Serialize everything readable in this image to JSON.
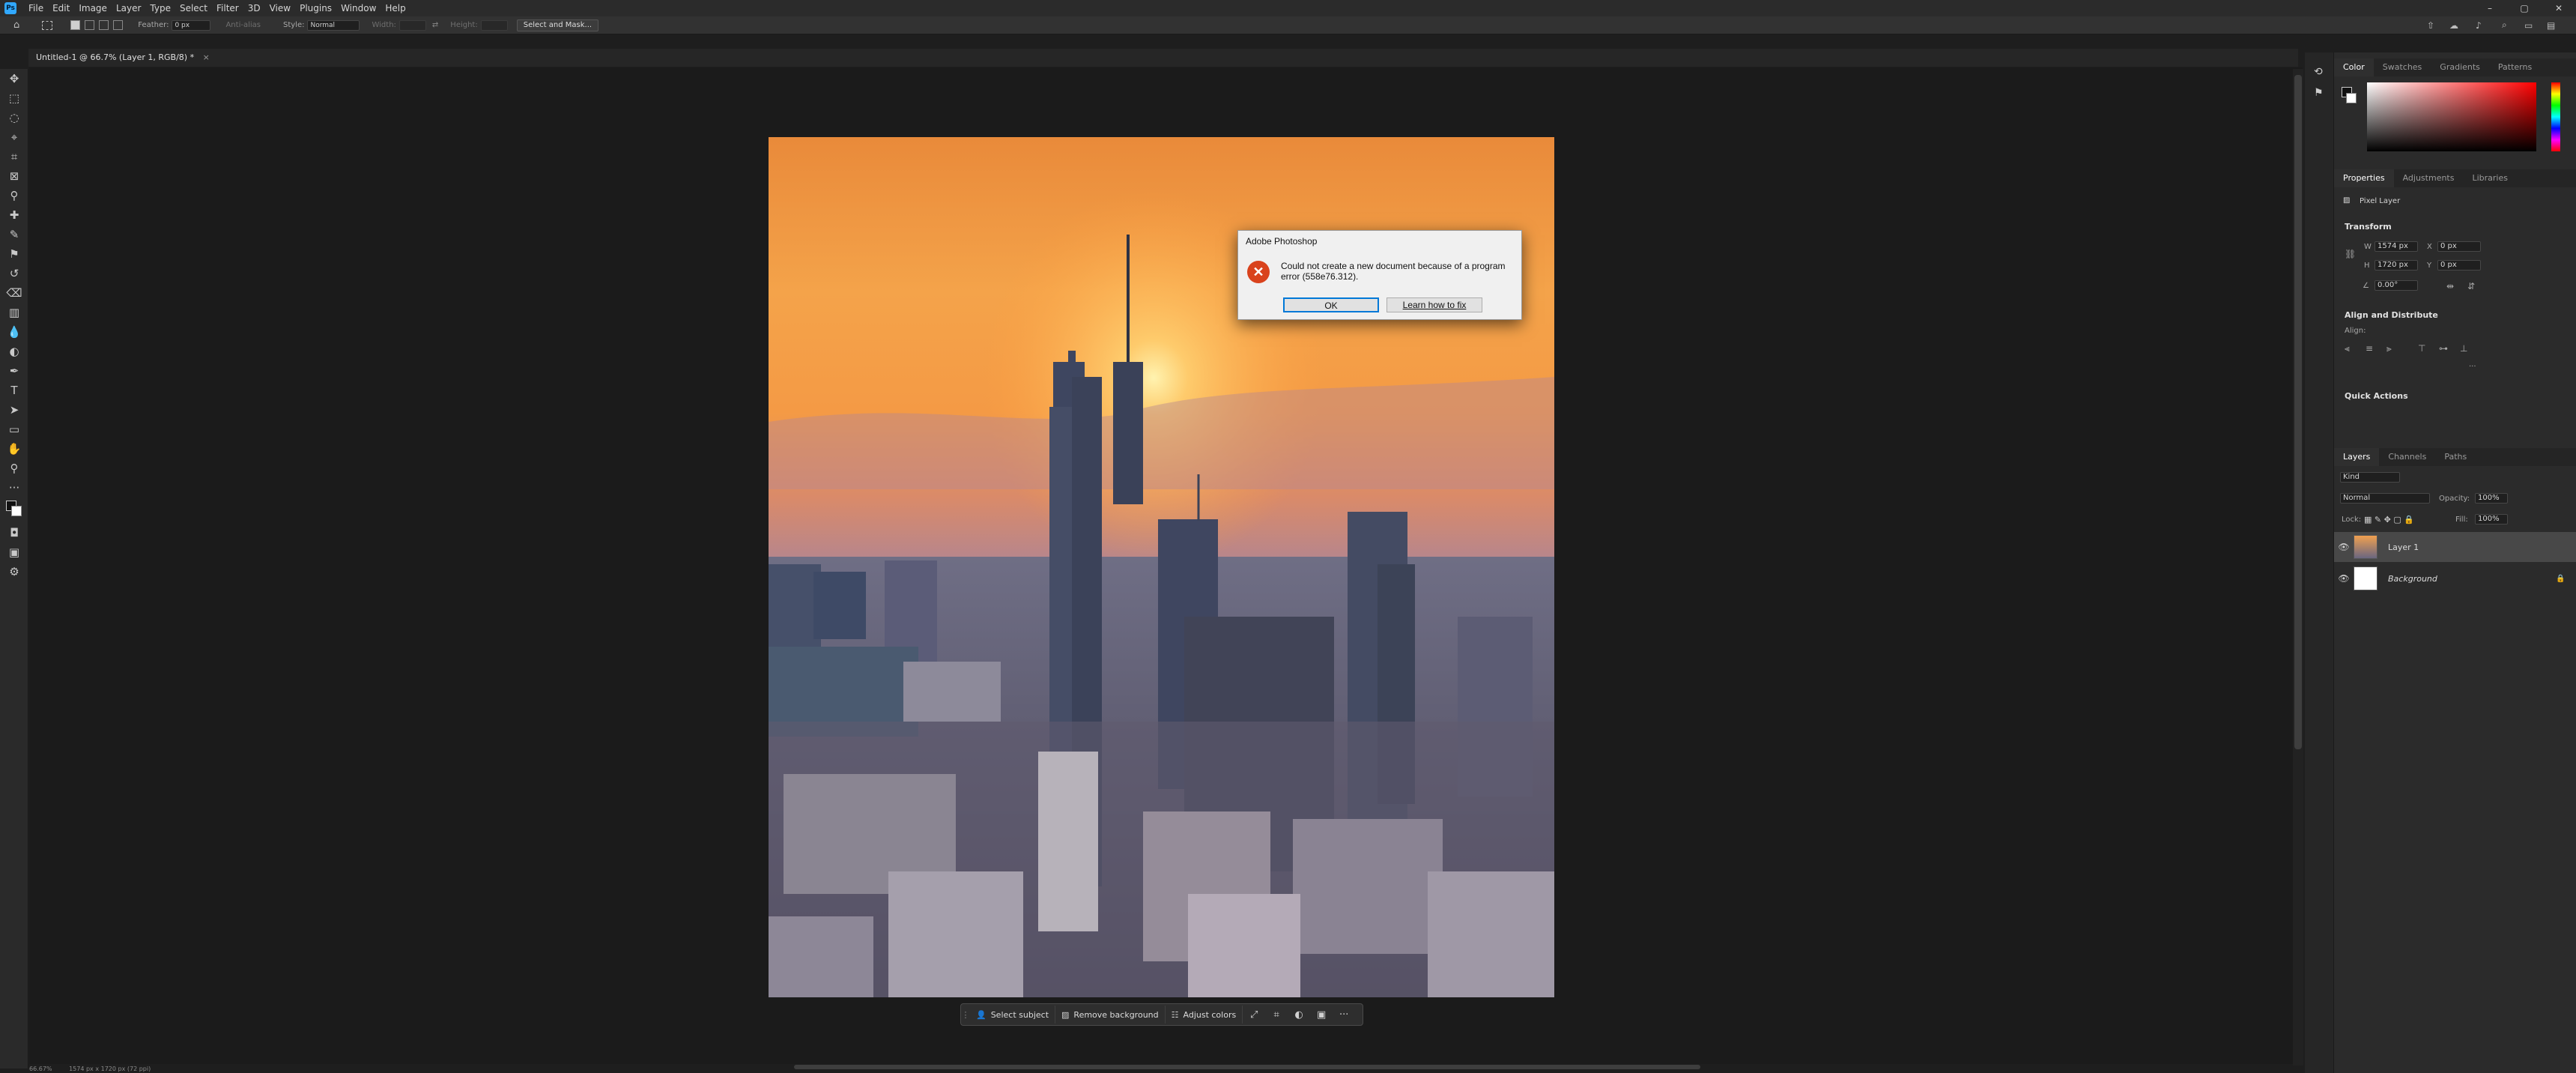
{
  "app": {
    "name": "Adobe Photoshop",
    "logo": "Ps"
  },
  "menu": [
    "File",
    "Edit",
    "Image",
    "Layer",
    "Type",
    "Select",
    "Filter",
    "3D",
    "View",
    "Plugins",
    "Window",
    "Help"
  ],
  "window_controls": {
    "minimize": "–",
    "maximize": "▢",
    "close": "✕"
  },
  "options_bar": {
    "feather_label": "Feather:",
    "feather_value": "0 px",
    "antialias_label": "Anti-alias",
    "style_label": "Style:",
    "style_value": "Normal",
    "width_label": "Width:",
    "height_label": "Height:",
    "select_mask_label": "Select and Mask..."
  },
  "document_tab": {
    "title": "Untitled-1 @ 66.7% (Layer 1, RGB/8) *",
    "close": "×"
  },
  "status": {
    "zoom": "66.67%",
    "info": "1574 px x 1720 px (72 ppi)"
  },
  "dialog": {
    "title": "Adobe Photoshop",
    "message": "Could not create a new document because of a program error (558e76.312).",
    "ok_label": "OK",
    "learn_label": "Learn how to fix"
  },
  "context_bar": {
    "select_subject": "Select subject",
    "remove_background": "Remove background",
    "adjust_colors": "Adjust colors",
    "more": "···"
  },
  "color_panel": {
    "tabs": [
      "Color",
      "Swatches",
      "Gradients",
      "Patterns"
    ],
    "active": 0
  },
  "properties_panel": {
    "tabs": [
      "Properties",
      "Adjustments",
      "Libraries"
    ],
    "layer_type": "Pixel Layer",
    "transform_label": "Transform",
    "w_label": "W",
    "w_value": "1574 px",
    "h_label": "H",
    "h_value": "1720 px",
    "x_label": "X",
    "x_value": "0 px",
    "y_label": "Y",
    "y_value": "0 px",
    "angle_value": "0.00°",
    "align_label": "Align and Distribute",
    "align_sub": "Align:",
    "quick_actions": "Quick Actions"
  },
  "layers_panel": {
    "tabs": [
      "Layers",
      "Channels",
      "Paths"
    ],
    "filter_kind": "Kind",
    "blend_mode": "Normal",
    "opacity_label": "Opacity:",
    "opacity_value": "100%",
    "lock_label": "Lock:",
    "fill_label": "Fill:",
    "fill_value": "100%",
    "layers": [
      {
        "name": "Layer 1",
        "selected": true
      },
      {
        "name": "Background",
        "selected": false
      }
    ]
  }
}
